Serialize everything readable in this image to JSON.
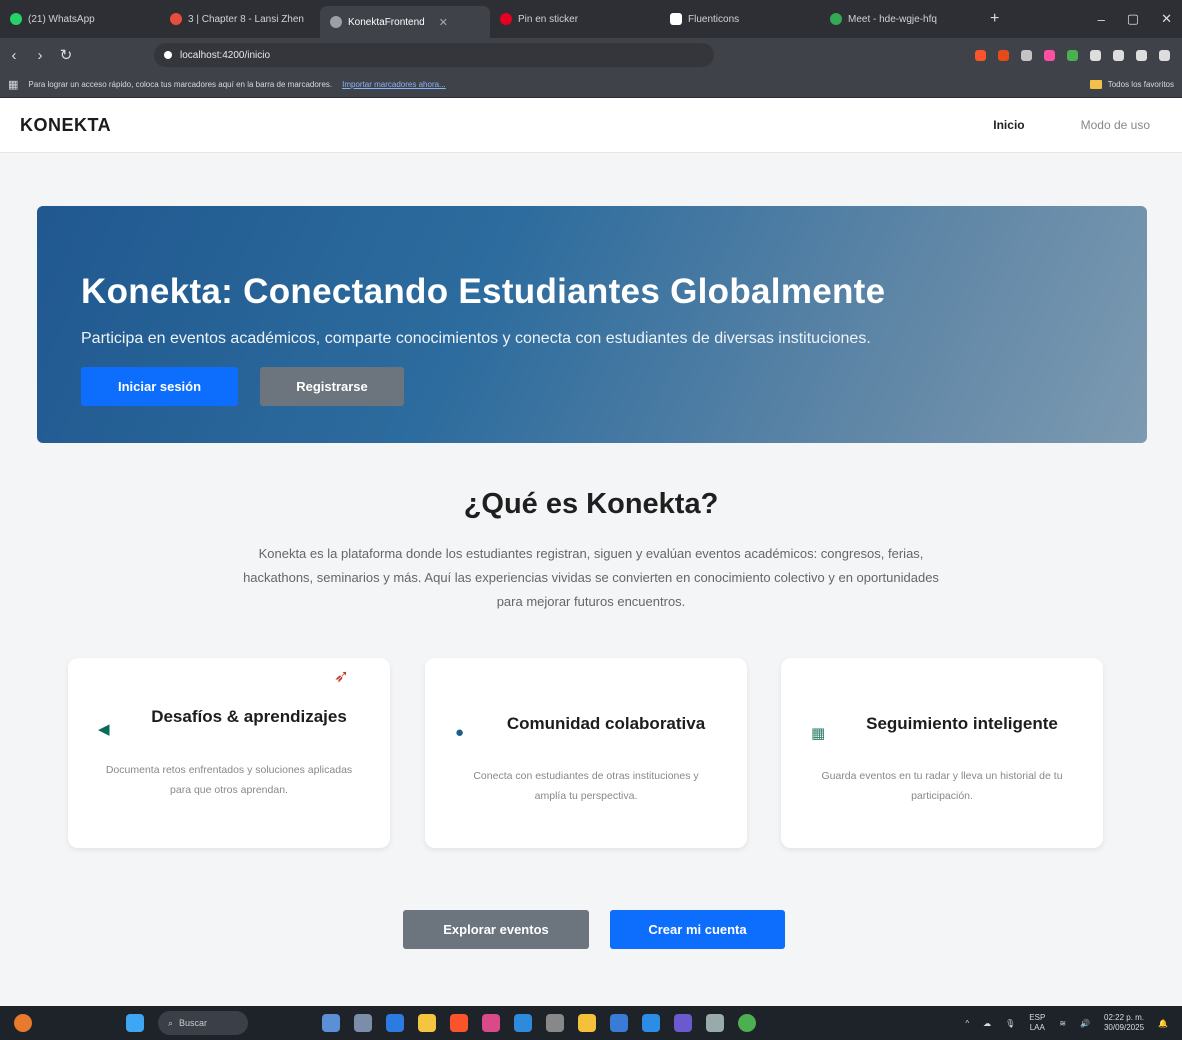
{
  "browser": {
    "tabs": [
      {
        "label": "(21) WhatsApp",
        "color": "#25d366"
      },
      {
        "label": "3 | Chapter 8 - Lansi Zhen",
        "color": "#e74c3c"
      },
      {
        "label": "KonektaFrontend",
        "color": "#9aa0a6"
      },
      {
        "label": "Pin en sticker",
        "color": "#e60023"
      },
      {
        "label": "Fluenticons",
        "color": "#ffffff"
      },
      {
        "label": "Meet - hde-wgje-hfq",
        "color": "#34a853"
      }
    ],
    "url": "localhost:4200/inicio",
    "bookmarks_hint": "Para lograr un acceso rápido, coloca tus marcadores aquí en la barra de marcadores.",
    "bookmarks_link": "Importar marcadores ahora...",
    "all_favorites": "Todos los favoritos"
  },
  "app": {
    "brand": "KONEKTA",
    "nav": {
      "home": "Inicio",
      "usage": "Modo de uso"
    }
  },
  "hero": {
    "title": "Konekta: Conectando Estudiantes Globalmente",
    "subtitle": "Participa en eventos académicos, comparte conocimientos y conecta con estudiantes de diversas instituciones.",
    "login_label": "Iniciar sesión",
    "register_label": "Registrarse"
  },
  "about": {
    "title": "¿Qué es Konekta?",
    "text": "Konekta es la plataforma donde los estudiantes registran, siguen y evalúan eventos académicos: congresos, ferias, hackathons, seminarios y más. Aquí las experiencias vividas se convierten en conocimiento colectivo y en oportunidades para mejorar futuros encuentros."
  },
  "cards": [
    {
      "icon": "rocket-icon",
      "title": "Desafíos & aprendizajes",
      "desc": "Documenta retos enfrentados y soluciones aplicadas para que otros aprendan."
    },
    {
      "icon": "globe-icon",
      "title": "Comunidad colaborativa",
      "desc": "Conecta con estudiantes de otras instituciones y amplía tu perspectiva."
    },
    {
      "icon": "calendar-icon",
      "title": "Seguimiento inteligente",
      "desc": "Guarda eventos en tu radar y lleva un historial de tu participación."
    }
  ],
  "cta": {
    "explore_label": "Explorar eventos",
    "create_label": "Crear mi cuenta"
  },
  "taskbar": {
    "search_placeholder": "Buscar",
    "lang": "ESP",
    "lang_sub": "LAA",
    "time": "02:22 p. m.",
    "date": "30/09/2025"
  },
  "colors": {
    "primary": "#0d6efd",
    "secondary": "#6c757d",
    "hero_start": "#20588f",
    "hero_end": "#7d9ab1"
  }
}
